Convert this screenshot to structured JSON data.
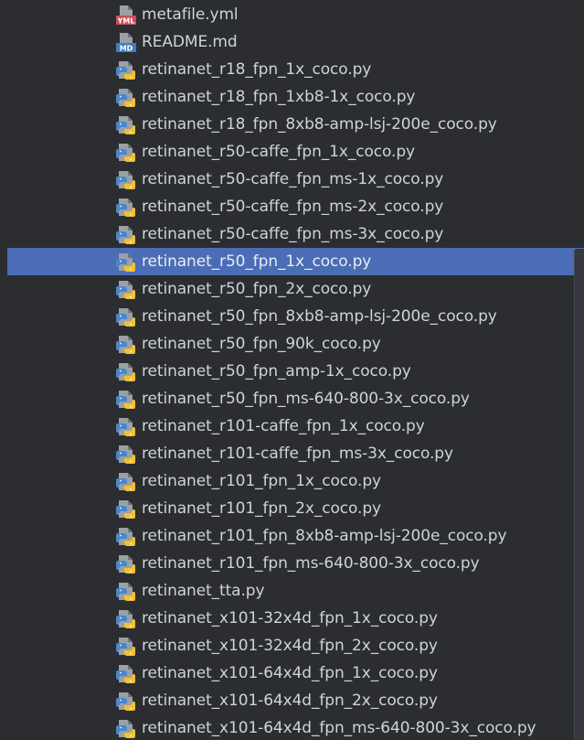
{
  "files": [
    {
      "name": "metafile.yml",
      "icon": "yml-file-icon",
      "selected": false
    },
    {
      "name": "README.md",
      "icon": "md-file-icon",
      "selected": false
    },
    {
      "name": "retinanet_r18_fpn_1x_coco.py",
      "icon": "python-file-icon",
      "selected": false
    },
    {
      "name": "retinanet_r18_fpn_1xb8-1x_coco.py",
      "icon": "python-file-icon",
      "selected": false
    },
    {
      "name": "retinanet_r18_fpn_8xb8-amp-lsj-200e_coco.py",
      "icon": "python-file-icon",
      "selected": false
    },
    {
      "name": "retinanet_r50-caffe_fpn_1x_coco.py",
      "icon": "python-file-icon",
      "selected": false
    },
    {
      "name": "retinanet_r50-caffe_fpn_ms-1x_coco.py",
      "icon": "python-file-icon",
      "selected": false
    },
    {
      "name": "retinanet_r50-caffe_fpn_ms-2x_coco.py",
      "icon": "python-file-icon",
      "selected": false
    },
    {
      "name": "retinanet_r50-caffe_fpn_ms-3x_coco.py",
      "icon": "python-file-icon",
      "selected": false
    },
    {
      "name": "retinanet_r50_fpn_1x_coco.py",
      "icon": "python-file-icon",
      "selected": true
    },
    {
      "name": "retinanet_r50_fpn_2x_coco.py",
      "icon": "python-file-icon",
      "selected": false
    },
    {
      "name": "retinanet_r50_fpn_8xb8-amp-lsj-200e_coco.py",
      "icon": "python-file-icon",
      "selected": false
    },
    {
      "name": "retinanet_r50_fpn_90k_coco.py",
      "icon": "python-file-icon",
      "selected": false
    },
    {
      "name": "retinanet_r50_fpn_amp-1x_coco.py",
      "icon": "python-file-icon",
      "selected": false
    },
    {
      "name": "retinanet_r50_fpn_ms-640-800-3x_coco.py",
      "icon": "python-file-icon",
      "selected": false
    },
    {
      "name": "retinanet_r101-caffe_fpn_1x_coco.py",
      "icon": "python-file-icon",
      "selected": false
    },
    {
      "name": "retinanet_r101-caffe_fpn_ms-3x_coco.py",
      "icon": "python-file-icon",
      "selected": false
    },
    {
      "name": "retinanet_r101_fpn_1x_coco.py",
      "icon": "python-file-icon",
      "selected": false
    },
    {
      "name": "retinanet_r101_fpn_2x_coco.py",
      "icon": "python-file-icon",
      "selected": false
    },
    {
      "name": "retinanet_r101_fpn_8xb8-amp-lsj-200e_coco.py",
      "icon": "python-file-icon",
      "selected": false
    },
    {
      "name": "retinanet_r101_fpn_ms-640-800-3x_coco.py",
      "icon": "python-file-icon",
      "selected": false
    },
    {
      "name": "retinanet_tta.py",
      "icon": "python-file-icon",
      "selected": false
    },
    {
      "name": "retinanet_x101-32x4d_fpn_1x_coco.py",
      "icon": "python-file-icon",
      "selected": false
    },
    {
      "name": "retinanet_x101-32x4d_fpn_2x_coco.py",
      "icon": "python-file-icon",
      "selected": false
    },
    {
      "name": "retinanet_x101-64x4d_fpn_1x_coco.py",
      "icon": "python-file-icon",
      "selected": false
    },
    {
      "name": "retinanet_x101-64x4d_fpn_2x_coco.py",
      "icon": "python-file-icon",
      "selected": false
    },
    {
      "name": "retinanet_x101-64x4d_fpn_ms-640-800-3x_coco.py",
      "icon": "python-file-icon",
      "selected": false
    }
  ],
  "icon_labels": {
    "yml": "YML",
    "md": "MD"
  },
  "colors": {
    "background": "#2b2d30",
    "selection": "#4a6db5",
    "text": "#cfd3da",
    "python_blue": "#4a86c8",
    "python_yellow": "#f2c230",
    "yml_red": "#c8505a",
    "md_blue": "#3d7fc2"
  }
}
